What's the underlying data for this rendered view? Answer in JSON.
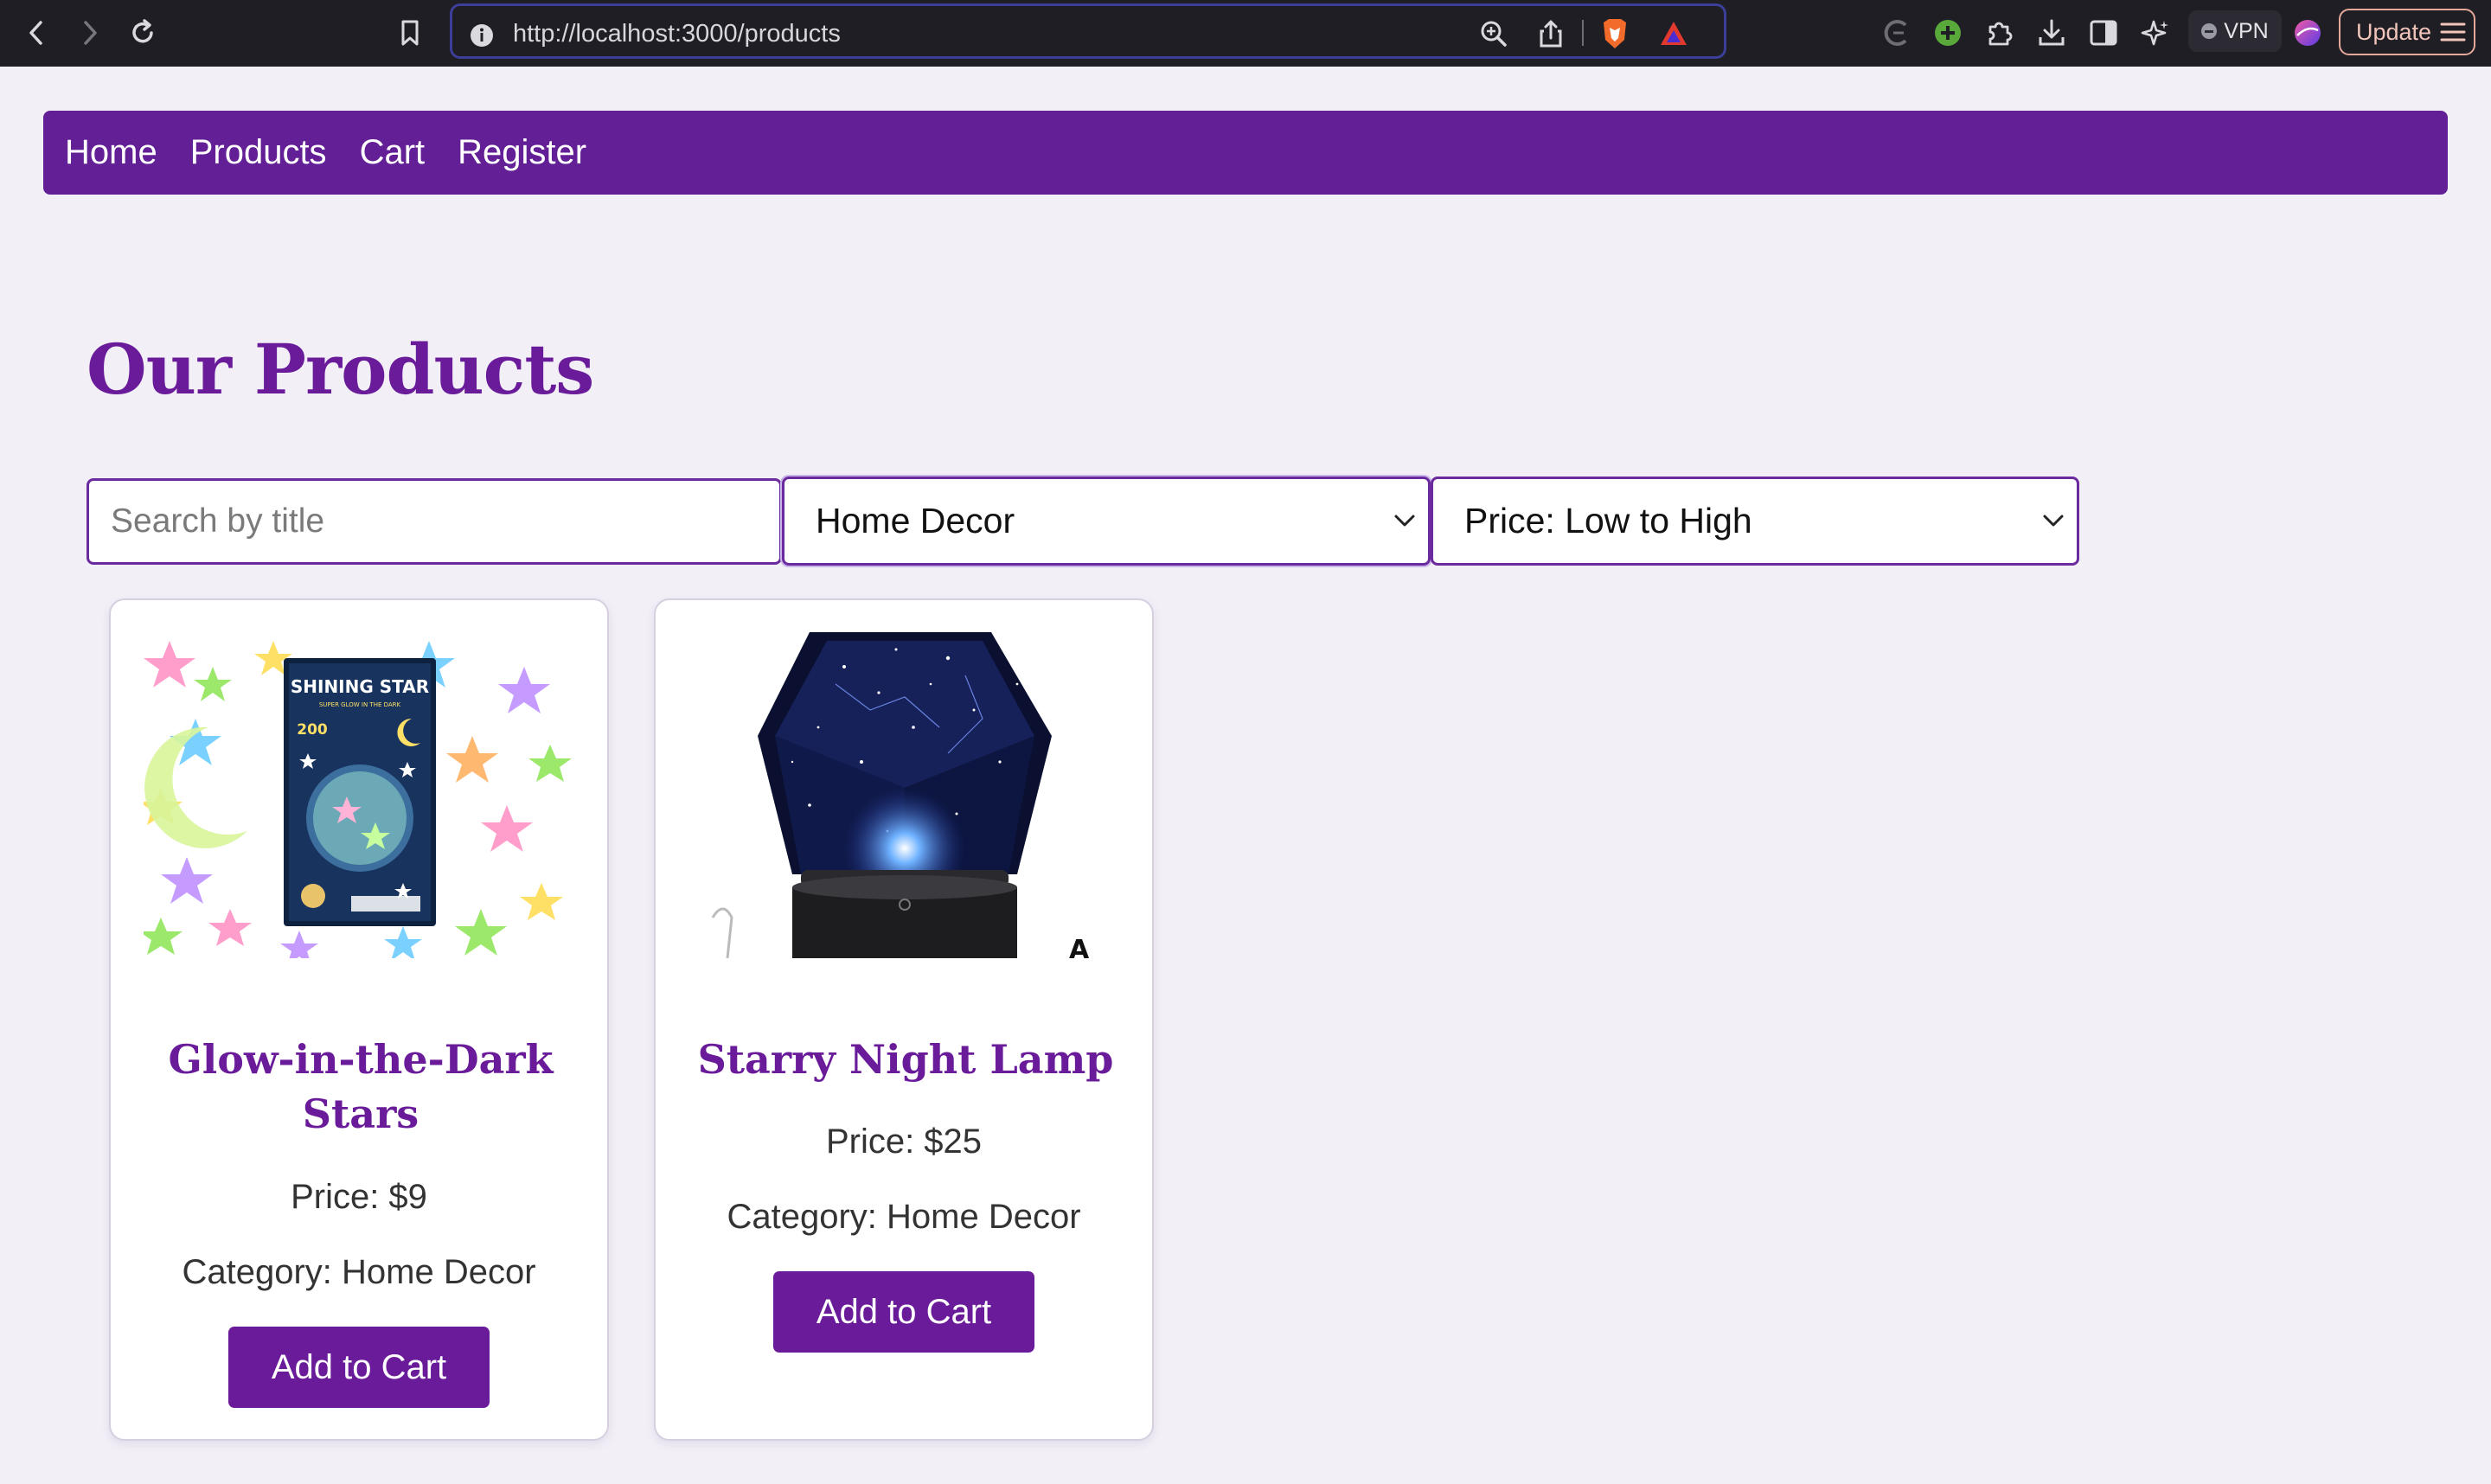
{
  "browser": {
    "url": "http://localhost:3000/products",
    "vpn_label": "VPN",
    "update_label": "Update"
  },
  "nav": {
    "items": [
      {
        "label": "Home"
      },
      {
        "label": "Products"
      },
      {
        "label": "Cart"
      },
      {
        "label": "Register"
      }
    ]
  },
  "main": {
    "title": "Our Products",
    "search_placeholder": "Search by title",
    "category_selected": "Home Decor",
    "sort_selected": "Price: Low to High"
  },
  "products": [
    {
      "name": "Glow-in-the-Dark Stars",
      "price": "Price: $9",
      "category": "Category: Home Decor",
      "button": "Add to Cart",
      "image_text": [
        "SHINING STAR",
        "SUPER GLOW IN THE DARK",
        "200"
      ]
    },
    {
      "name": "Starry Night Lamp",
      "price": "Price: $25",
      "category": "Category: Home Decor",
      "button": "Add to Cart"
    }
  ],
  "colors": {
    "brand": "#621f96",
    "accent": "#6a1b9a",
    "background": "#f2eff7"
  }
}
